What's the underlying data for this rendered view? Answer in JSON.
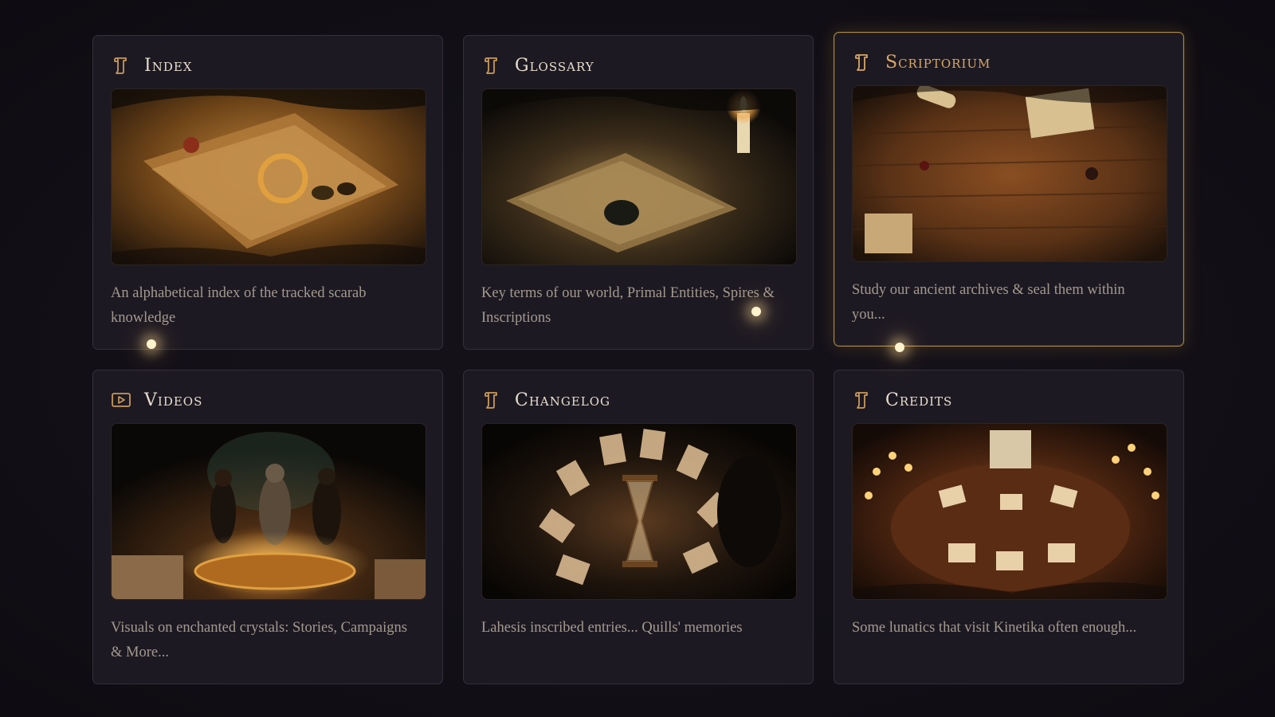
{
  "cards": [
    {
      "title": "Index",
      "icon": "scroll-icon",
      "description": "An alphabetical index of the tracked scarab knowledge",
      "image": "Open ancient book with golden ring and scarab beetle"
    },
    {
      "title": "Glossary",
      "icon": "scroll-icon",
      "description": "Key terms of our world, Primal Entities, Spires & Inscriptions",
      "image": "Candle-lit open book with dark stone"
    },
    {
      "title": "Scriptorium",
      "icon": "scroll-icon",
      "description": "Study our ancient archives & seal them within you...",
      "image": "Wooden desk scattered with scrolls and books"
    },
    {
      "title": "Videos",
      "icon": "video-icon",
      "description": "Visuals on enchanted crystals: Stories, Campaigns & More...",
      "image": "Armored figures above a glowing brazier"
    },
    {
      "title": "Changelog",
      "icon": "scroll-icon",
      "description": "Lahesis inscribed entries... Quills' memories",
      "image": "Hourglass encircled by floating pages"
    },
    {
      "title": "Credits",
      "icon": "scroll-icon",
      "description": "Some lunatics that visit Kinetika often enough...",
      "image": "Candle-lit council table with papers"
    }
  ],
  "colors": {
    "accent": "#d8a865",
    "active_border": "#b08a45",
    "card_bg": "#1d1922",
    "page_bg": "#141119",
    "title": "#e6dccd",
    "desc": "#a39a8e"
  }
}
